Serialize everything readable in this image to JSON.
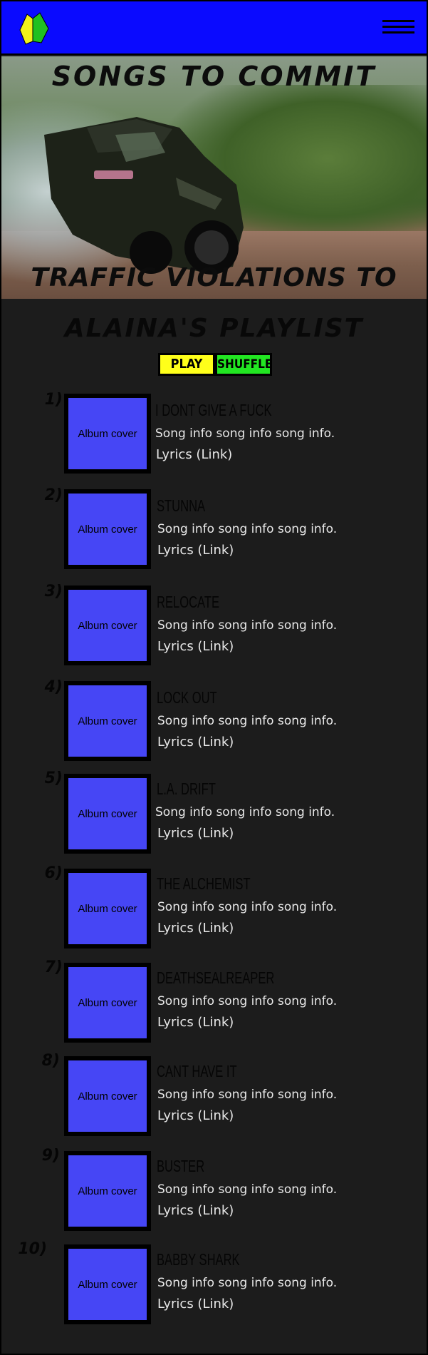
{
  "header": {
    "logo_icon": "beginner-leaf-icon",
    "menu_icon": "hamburger-menu-icon"
  },
  "hero": {
    "title_top": "Songs to Commit",
    "title_bottom": "Traffic Violations to",
    "image": "drifting-car-photo"
  },
  "playlist": {
    "title": "Alaina's Playlist",
    "play_label": "PLAY",
    "shuffle_label": "SHUFFLE",
    "songs": [
      {
        "number": "1)",
        "cover": "Album cover",
        "title": "I DONT GIVE A FUCK",
        "info": "Song info song info song info.",
        "lyrics": "Lyrics (Link)"
      },
      {
        "number": "2)",
        "cover": "Album cover",
        "title": "STUNNA",
        "info": "Song info song info song info.",
        "lyrics": "Lyrics (Link)"
      },
      {
        "number": "3)",
        "cover": "Album cover",
        "title": "RELOCATE",
        "info": "Song info song info song info.",
        "lyrics": "Lyrics (Link)"
      },
      {
        "number": "4)",
        "cover": "Album cover",
        "title": "LOCK OUT",
        "info": "Song info song info song info.",
        "lyrics": "Lyrics (Link)"
      },
      {
        "number": "5)",
        "cover": "Album cover",
        "title": "L.A. DRIFT",
        "info": "Song info song info song info.",
        "lyrics": "Lyrics (Link)"
      },
      {
        "number": "6)",
        "cover": "Album cover",
        "title": "THE ALCHEMIST",
        "info": "Song info song info song info.",
        "lyrics": "Lyrics (Link)"
      },
      {
        "number": "7)",
        "cover": "Album cover",
        "title": "DEATHSEALREAPER",
        "info": "Song info song info song info.",
        "lyrics": "Lyrics (Link)"
      },
      {
        "number": "8)",
        "cover": "Album cover",
        "title": "CANT HAVE IT",
        "info": "Song info song info song info.",
        "lyrics": "Lyrics (Link)"
      },
      {
        "number": "9)",
        "cover": "Album cover",
        "title": "BUSTER",
        "info": "Song info song info song info.",
        "lyrics": "Lyrics (Link)"
      },
      {
        "number": "10)",
        "cover": "Album cover",
        "title": "BABBY SHARK",
        "info": "Song info song info song info.",
        "lyrics": "Lyrics (Link)"
      }
    ]
  },
  "colors": {
    "header_bg": "#0a0aff",
    "page_bg": "#1c1c1c",
    "play_button": "#ffff1a",
    "shuffle_button": "#22e622",
    "album_cover": "#4646f5"
  }
}
